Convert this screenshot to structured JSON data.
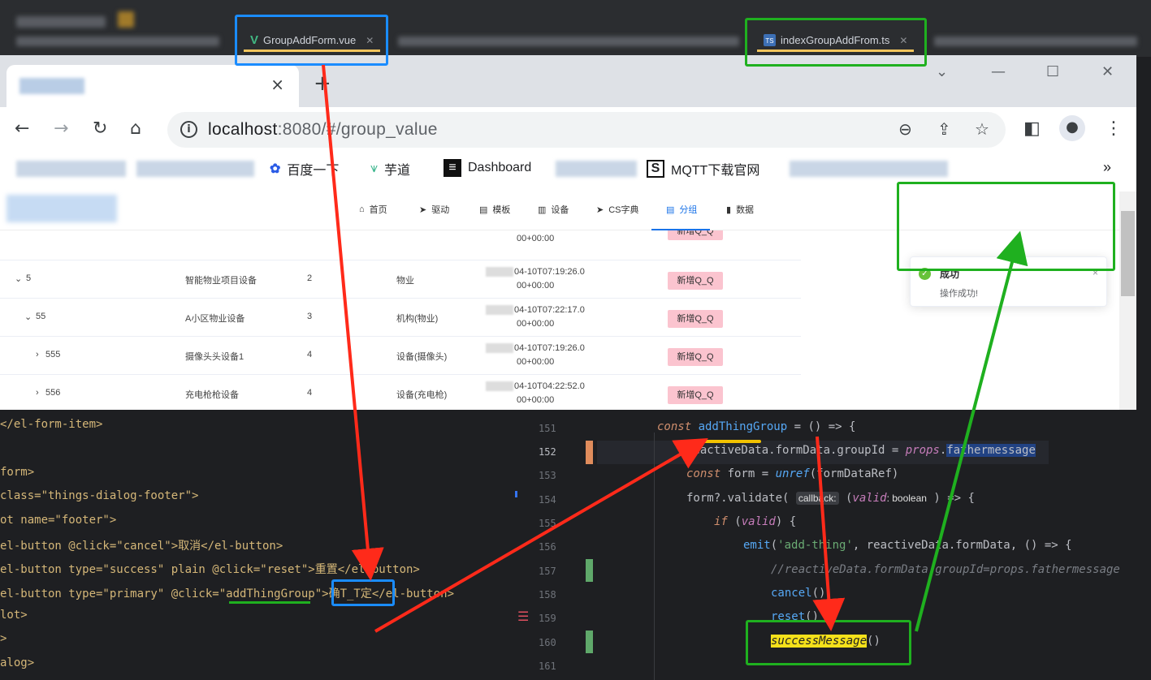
{
  "ide_tabs": [
    {
      "label": "GroupAddForm.vue",
      "icon": "vue-icon"
    },
    {
      "label": "indexGroupAddFrom.ts",
      "icon": "ts-icon"
    }
  ],
  "browser": {
    "new_tab_symbol": "+",
    "close_symbol": "×",
    "url_host": "localhost",
    "url_path": ":8080/#/group_value",
    "bookmarks": [
      {
        "label": "百度一下",
        "icon": "baidu-icon"
      },
      {
        "label": "芋道",
        "icon": "yudao-icon"
      },
      {
        "label": "Dashboard",
        "icon": "dashboard-icon"
      },
      {
        "label": "MQTT下载官网",
        "icon": "mqtt-icon"
      }
    ],
    "more_symbol": "»"
  },
  "app": {
    "nav": [
      {
        "label": "首页",
        "icon": "home-icon"
      },
      {
        "label": "驱动",
        "icon": "send-icon"
      },
      {
        "label": "模板",
        "icon": "doc-icon"
      },
      {
        "label": "设备",
        "icon": "chart-icon"
      },
      {
        "label": "CS字典",
        "icon": "send-icon"
      },
      {
        "label": "分组",
        "icon": "doc-icon",
        "active": true
      },
      {
        "label": "数据",
        "icon": "bar-icon"
      }
    ],
    "rows": [
      {
        "id": "5",
        "arrow": "⌄",
        "name": "智能物业项目设备",
        "level": "2",
        "type": "物业",
        "time1": "04-10T07:19:26.0",
        "time2": "00+00:00",
        "action": "新增Q_Q"
      },
      {
        "id": "55",
        "arrow": "⌄",
        "name": "A小区物业设备",
        "level": "3",
        "type": "机构(物业)",
        "time1": "04-10T07:22:17.0",
        "time2": "00+00:00",
        "action": "新增Q_Q"
      },
      {
        "id": "555",
        "arrow": "›",
        "name": "摄像头头设备1",
        "level": "4",
        "type": "设备(摄像头)",
        "time1": "04-10T07:19:26.0",
        "time2": "00+00:00",
        "action": "新增Q_Q"
      },
      {
        "id": "556",
        "arrow": "›",
        "name": "充电枪枪设备",
        "level": "4",
        "type": "设备(充电枪)",
        "time1": "04-10T04:22:52.0",
        "time2": "00+00:00",
        "action": "新增Q_Q"
      }
    ],
    "partial_row": {
      "time2": "00+00:00",
      "action": "新增Q_Q"
    },
    "toast": {
      "title": "成功",
      "message": "操作成功!",
      "icon": "success-check-icon",
      "close": "×"
    }
  },
  "left_code": [
    "</el-form-item>",
    "",
    "form>",
    "class=\"things-dialog-footer\">",
    "ot name=\"footer\">",
    "el-button @click=\"cancel\">取消</el-button>",
    "el-button type=\"success\" plain @click=\"reset\">重置</el-button>",
    "el-button type=\"primary\" @click=\"addThingGroup\">确T_T定</el-button>",
    "lot>",
    ">",
    "alog>"
  ],
  "right_code": {
    "line_numbers": [
      "151",
      "152",
      "153",
      "154",
      "155",
      "156",
      "157",
      "158",
      "159",
      "160",
      "161"
    ],
    "hint_callback": "callback:",
    "hint_boolean": ": boolean",
    "comment": "//reactiveData.formData.groupId=props.fathermessage",
    "success_call": "successMessage"
  },
  "colors": {
    "annotation_red": "#ff2a1a",
    "annotation_green": "#1fb01f",
    "annotation_blue": "#1a8cff",
    "accent_tag": "#fbc4cf",
    "highlight_yellow": "#f5e11a"
  }
}
